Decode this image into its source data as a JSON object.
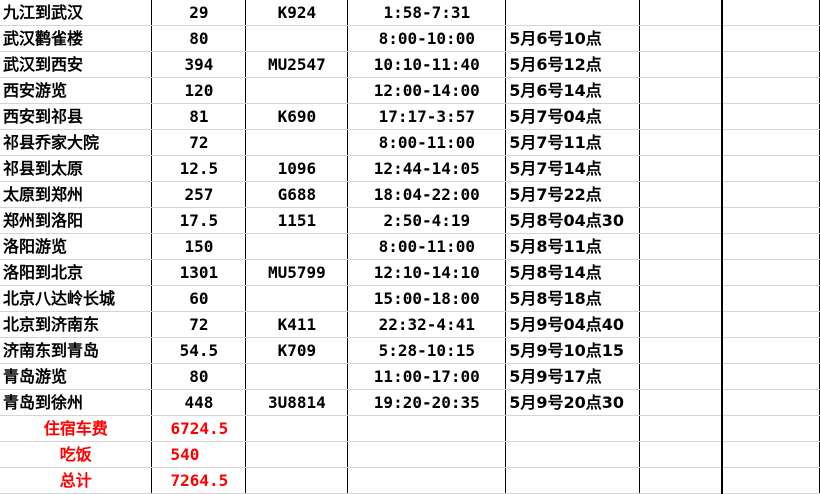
{
  "accent_colors": {
    "total_text": "#ff0000",
    "amount_text": "#1f2a6b",
    "grid": "#000000"
  },
  "rows": [
    {
      "route": "九江到武汉",
      "cost": "29",
      "train": "K924",
      "time": "1:58-7:31",
      "arrive": ""
    },
    {
      "route": "武汉鹳雀楼",
      "cost": "80",
      "train": "",
      "time": "8:00-10:00",
      "arrive": "5月6号10点"
    },
    {
      "route": "武汉到西安",
      "cost": "394",
      "train": "MU2547",
      "time": "10:10-11:40",
      "arrive": "5月6号12点"
    },
    {
      "route": "西安游览",
      "cost": "120",
      "train": "",
      "time": "12:00-14:00",
      "arrive": "5月6号14点"
    },
    {
      "route": "西安到祁县",
      "cost": "81",
      "train": "K690",
      "time": "17:17-3:57",
      "arrive": "5月7号04点"
    },
    {
      "route": "祁县乔家大院",
      "cost": "72",
      "train": "",
      "time": "8:00-11:00",
      "arrive": "5月7号11点"
    },
    {
      "route": "祁县到太原",
      "cost": "12.5",
      "train": "1096",
      "time": "12:44-14:05",
      "arrive": "5月7号14点"
    },
    {
      "route": "太原到郑州",
      "cost": "257",
      "train": "G688",
      "time": "18:04-22:00",
      "arrive": "5月7号22点"
    },
    {
      "route": "郑州到洛阳",
      "cost": "17.5",
      "train": "1151",
      "time": "2:50-4:19",
      "arrive": "5月8号04点30"
    },
    {
      "route": "洛阳游览",
      "cost": "150",
      "train": "",
      "time": "8:00-11:00",
      "arrive": "5月8号11点"
    },
    {
      "route": "洛阳到北京",
      "cost": "1301",
      "train": "MU5799",
      "time": "12:10-14:10",
      "arrive": "5月8号14点"
    },
    {
      "route": "北京八达岭长城",
      "cost": "60",
      "train": "",
      "time": "15:00-18:00",
      "arrive": "5月8号18点"
    },
    {
      "route": "北京到济南东",
      "cost": "72",
      "train": "K411",
      "time": "22:32-4:41",
      "arrive": "5月9号04点40"
    },
    {
      "route": "济南东到青岛",
      "cost": "54.5",
      "train": "K709",
      "time": "5:28-10:15",
      "arrive": "5月9号10点15"
    },
    {
      "route": "青岛游览",
      "cost": "80",
      "train": "",
      "time": "11:00-17:00",
      "arrive": "5月9号17点"
    },
    {
      "route": "青岛到徐州",
      "cost": "448",
      "train": "3U8814",
      "time": "19:20-20:35",
      "arrive": "5月9号20点30"
    }
  ],
  "totals": [
    {
      "label": "住宿车费",
      "amount": "6724.5"
    },
    {
      "label": "吃饭",
      "amount": "540"
    },
    {
      "label": "总计",
      "amount": "7264.5"
    }
  ]
}
